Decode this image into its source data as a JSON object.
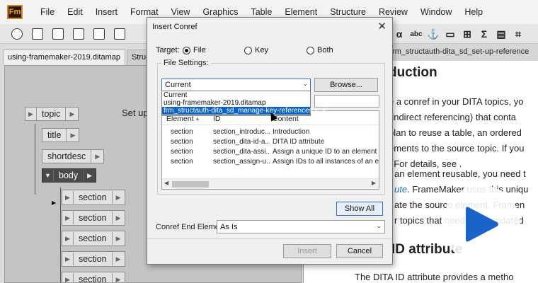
{
  "app": {
    "logo": "Fm",
    "menu": [
      "File",
      "Edit",
      "Insert",
      "Format",
      "View",
      "Graphics",
      "Table",
      "Element",
      "Structure",
      "Review",
      "Window",
      "Help"
    ],
    "toolbar_right_glyphs": [
      "α",
      "abc",
      "⚓",
      "▭",
      "⊞",
      "Σ",
      "▤",
      "⌗"
    ]
  },
  "left_panel": {
    "tabs": [
      "using-framemaker-2019.ditamap",
      "Struct"
    ],
    "tree": {
      "topic": "topic",
      "title": "title",
      "shortdesc": "shortdesc",
      "body": "body",
      "sections": [
        "section",
        "section",
        "section",
        "section",
        "section"
      ],
      "title_text": "Set up"
    }
  },
  "document": {
    "tab": "frm_structauth-dita_sd_set-up-reference",
    "heading": "duction",
    "lines": [
      "e a conref in your DITA topics, yo",
      "(indirect referencing) that conta",
      "plan to reuse a table, an ordered",
      "ements to the source topic. If you",
      ". For details, see ."
    ],
    "para2": [
      "an element reusable, you need t",
      "ate the source element, Framen",
      "r topics that need to be updated"
    ],
    "para2_link": "ute",
    "para2_rest": ". FrameMaker uses this uniqu",
    "heading2": "ID attribute",
    "last_line": "The DITA ID attribute provides a metho"
  },
  "dialog": {
    "title": "Insert Conref",
    "target_label": "Target:",
    "target_options": [
      "File",
      "Key",
      "Both"
    ],
    "target_selected": "File",
    "file_settings_label": "File Settings:",
    "file_combo_value": "Current",
    "dropdown_options": [
      "Current",
      "using-framemaker-2019.ditamap",
      "frm_structauth-dita_sd_manage-key-references.xml"
    ],
    "dropdown_selected_index": 2,
    "browse_label": "Browse...",
    "columns": [
      "Element",
      "ID",
      "Content"
    ],
    "rows": [
      {
        "element": "section",
        "id": "section_introduc...",
        "content": "Introduction"
      },
      {
        "element": "section",
        "id": "section_dita-id-a...",
        "content": "DITA ID attribute"
      },
      {
        "element": "section",
        "id": "section_dita-assi...",
        "content": "Assign a unique ID to an element"
      },
      {
        "element": "section",
        "id": "section_assign-u...",
        "content": "Assign IDs to all instances of an eleme"
      }
    ],
    "show_all_label": "Show All",
    "end_element_label": "Conref End Element:",
    "end_element_value": "As Is",
    "insert_label": "Insert",
    "cancel_label": "Cancel"
  }
}
